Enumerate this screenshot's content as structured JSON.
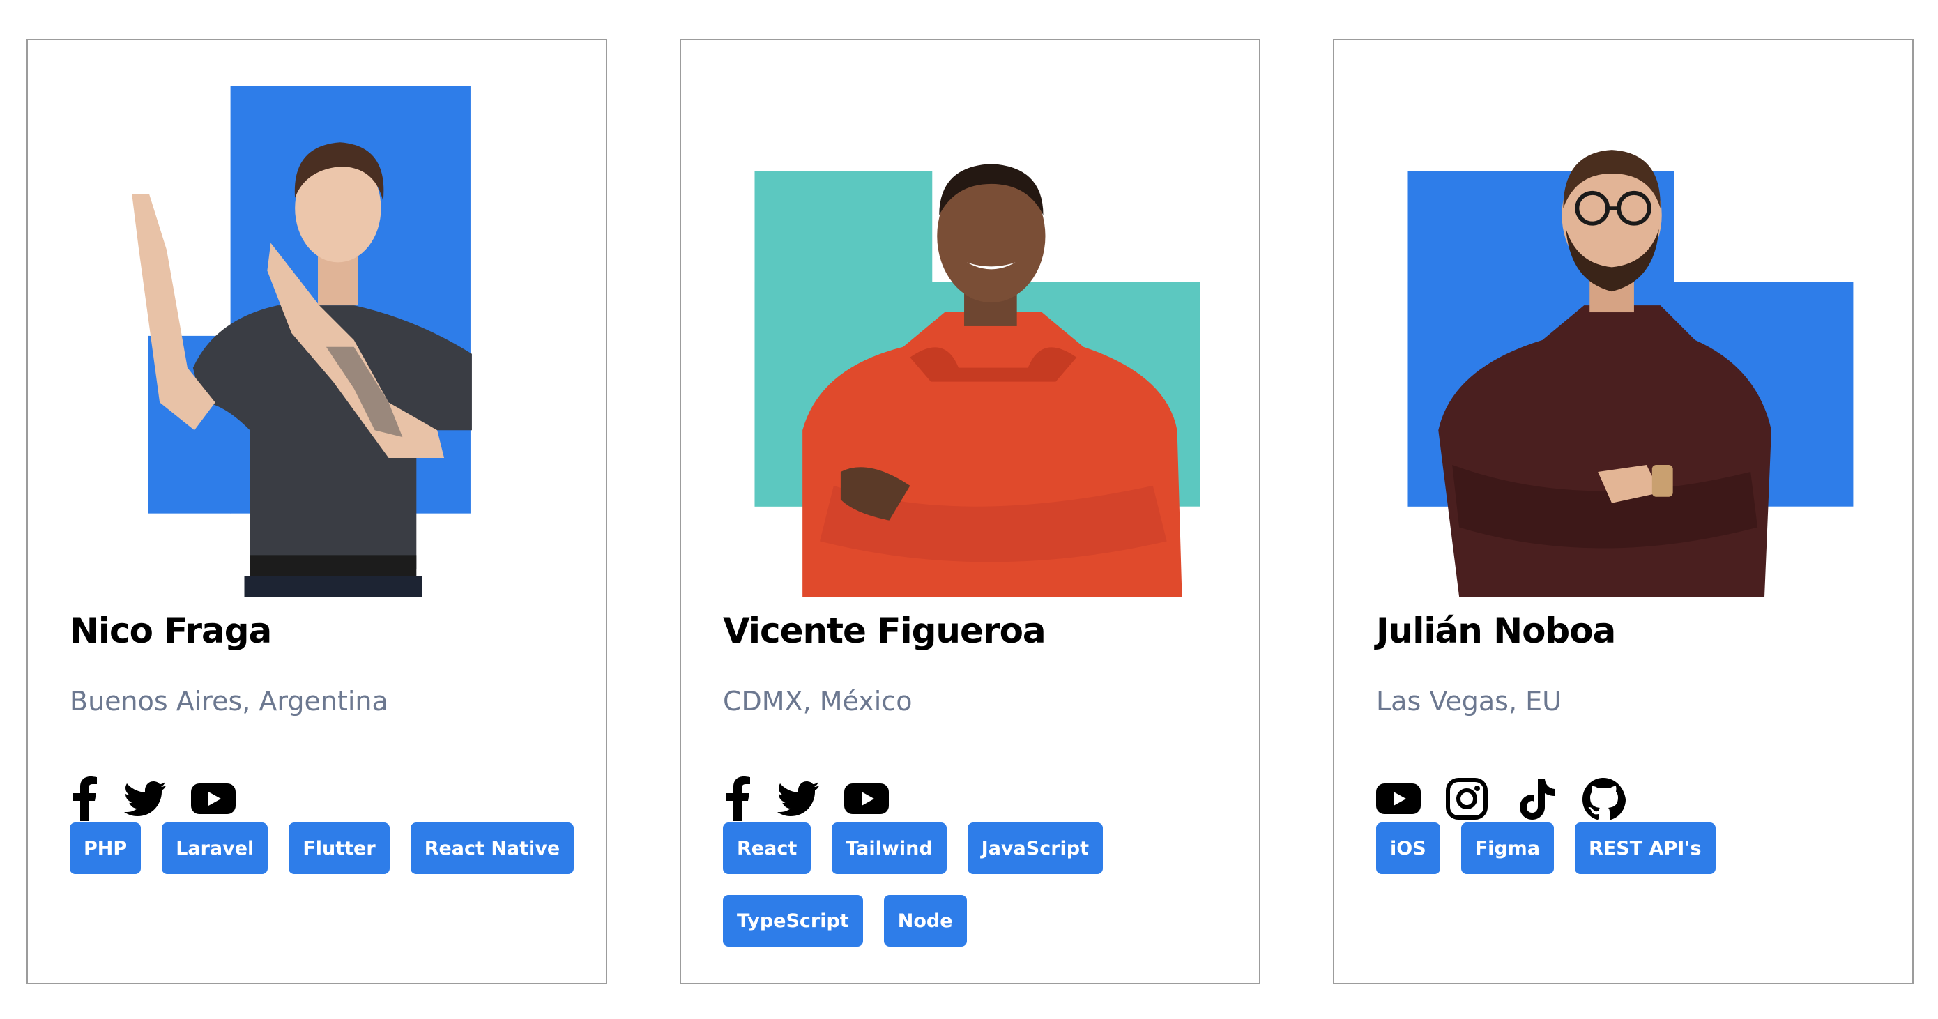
{
  "colors": {
    "blue": "#2e7de9",
    "teal": "#5cc8c0",
    "location_gray": "#6c7890"
  },
  "cards": [
    {
      "name": "Nico Fraga",
      "location": "Buenos Aires, Argentina",
      "socials": [
        "facebook-icon",
        "twitter-icon",
        "youtube-icon"
      ],
      "tags": [
        "PHP",
        "Laravel",
        "Flutter",
        "React Native"
      ]
    },
    {
      "name": "Vicente Figueroa",
      "location": "CDMX, México",
      "socials": [
        "facebook-icon",
        "twitter-icon",
        "youtube-icon"
      ],
      "tags": [
        "React",
        "Tailwind",
        "JavaScript",
        "TypeScript",
        "Node"
      ]
    },
    {
      "name": "Julián Noboa",
      "location": "Las Vegas, EU",
      "socials": [
        "youtube-icon",
        "instagram-icon",
        "tiktok-icon",
        "github-icon"
      ],
      "tags": [
        "iOS",
        "Figma",
        "REST API's"
      ]
    }
  ]
}
